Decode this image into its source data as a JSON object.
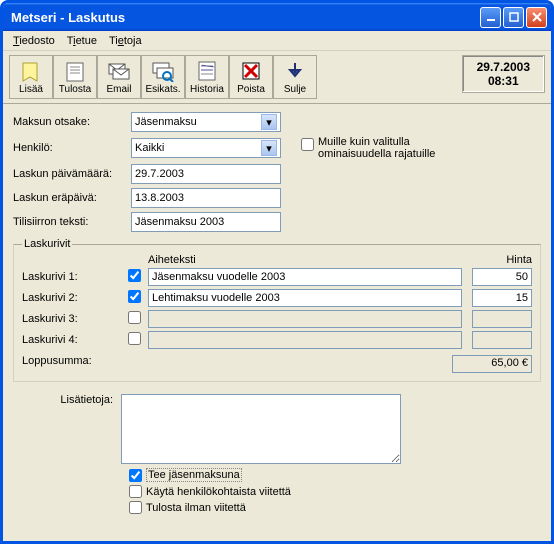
{
  "titlebar": {
    "title": "Metseri - Laskutus"
  },
  "menu": {
    "file": "Tiedosto",
    "record": "Tietue",
    "info": "Tietoja"
  },
  "toolbar": {
    "add": "Lisää",
    "print": "Tulosta",
    "email": "Email",
    "preview": "Esikats.",
    "history": "Historia",
    "delete": "Poista",
    "close": "Sulje"
  },
  "clock": {
    "date": "29.7.2003",
    "time": "08:31"
  },
  "labels": {
    "maksun_otsake": "Maksun otsake:",
    "henkilo": "Henkilö:",
    "laskun_pvm": "Laskun päivämäärä:",
    "laskun_erapv": "Laskun eräpäivä:",
    "tilisiirron": "Tilisiirron teksti:",
    "muille": "Muille kuin valitulla ominaisuudella rajatuille",
    "laskurivit": "Laskurivit",
    "aiheteksti": "Aiheteksti",
    "hinta": "Hinta",
    "l1": "Laskurivi 1:",
    "l2": "Laskurivi 2:",
    "l3": "Laskurivi 3:",
    "l4": "Laskurivi 4:",
    "loppusumma": "Loppusumma:",
    "lisatietoja": "Lisätietoja:"
  },
  "fields": {
    "maksun_otsake": "Jäsenmaksu",
    "henkilo": "Kaikki",
    "laskun_pvm": "29.7.2003",
    "laskun_erapv": "13.8.2003",
    "tilisiirron": "Jäsenmaksu 2003"
  },
  "rows": {
    "r1_text": "Jäsenmaksu vuodelle 2003",
    "r1_price": "50",
    "r2_text": "Lehtimaksu vuodelle 2003",
    "r2_price": "15",
    "r3_text": "",
    "r3_price": "",
    "r4_text": "",
    "r4_price": ""
  },
  "total": "65,00 €",
  "opts": {
    "jasen": "Tee jäsenmaksuna",
    "viite": "Käytä henkilökohtaista viitettä",
    "ilman": "Tulosta ilman viitettä"
  },
  "additional": ""
}
